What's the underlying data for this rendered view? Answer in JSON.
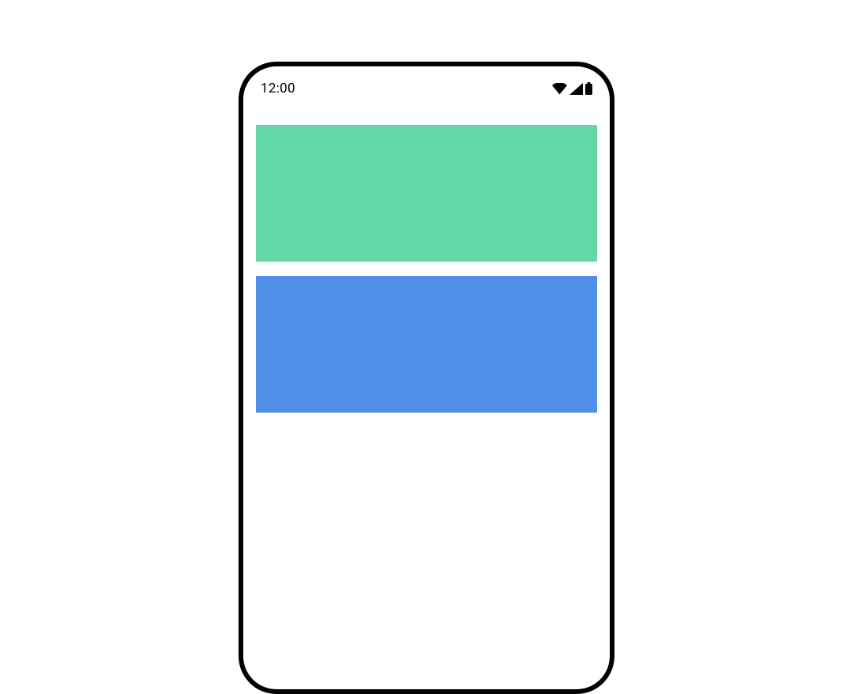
{
  "statusBar": {
    "time": "12:00"
  },
  "blocks": [
    {
      "name": "green-block",
      "color": "#62D8A4"
    },
    {
      "name": "blue-block",
      "color": "#4F8FE8"
    }
  ]
}
